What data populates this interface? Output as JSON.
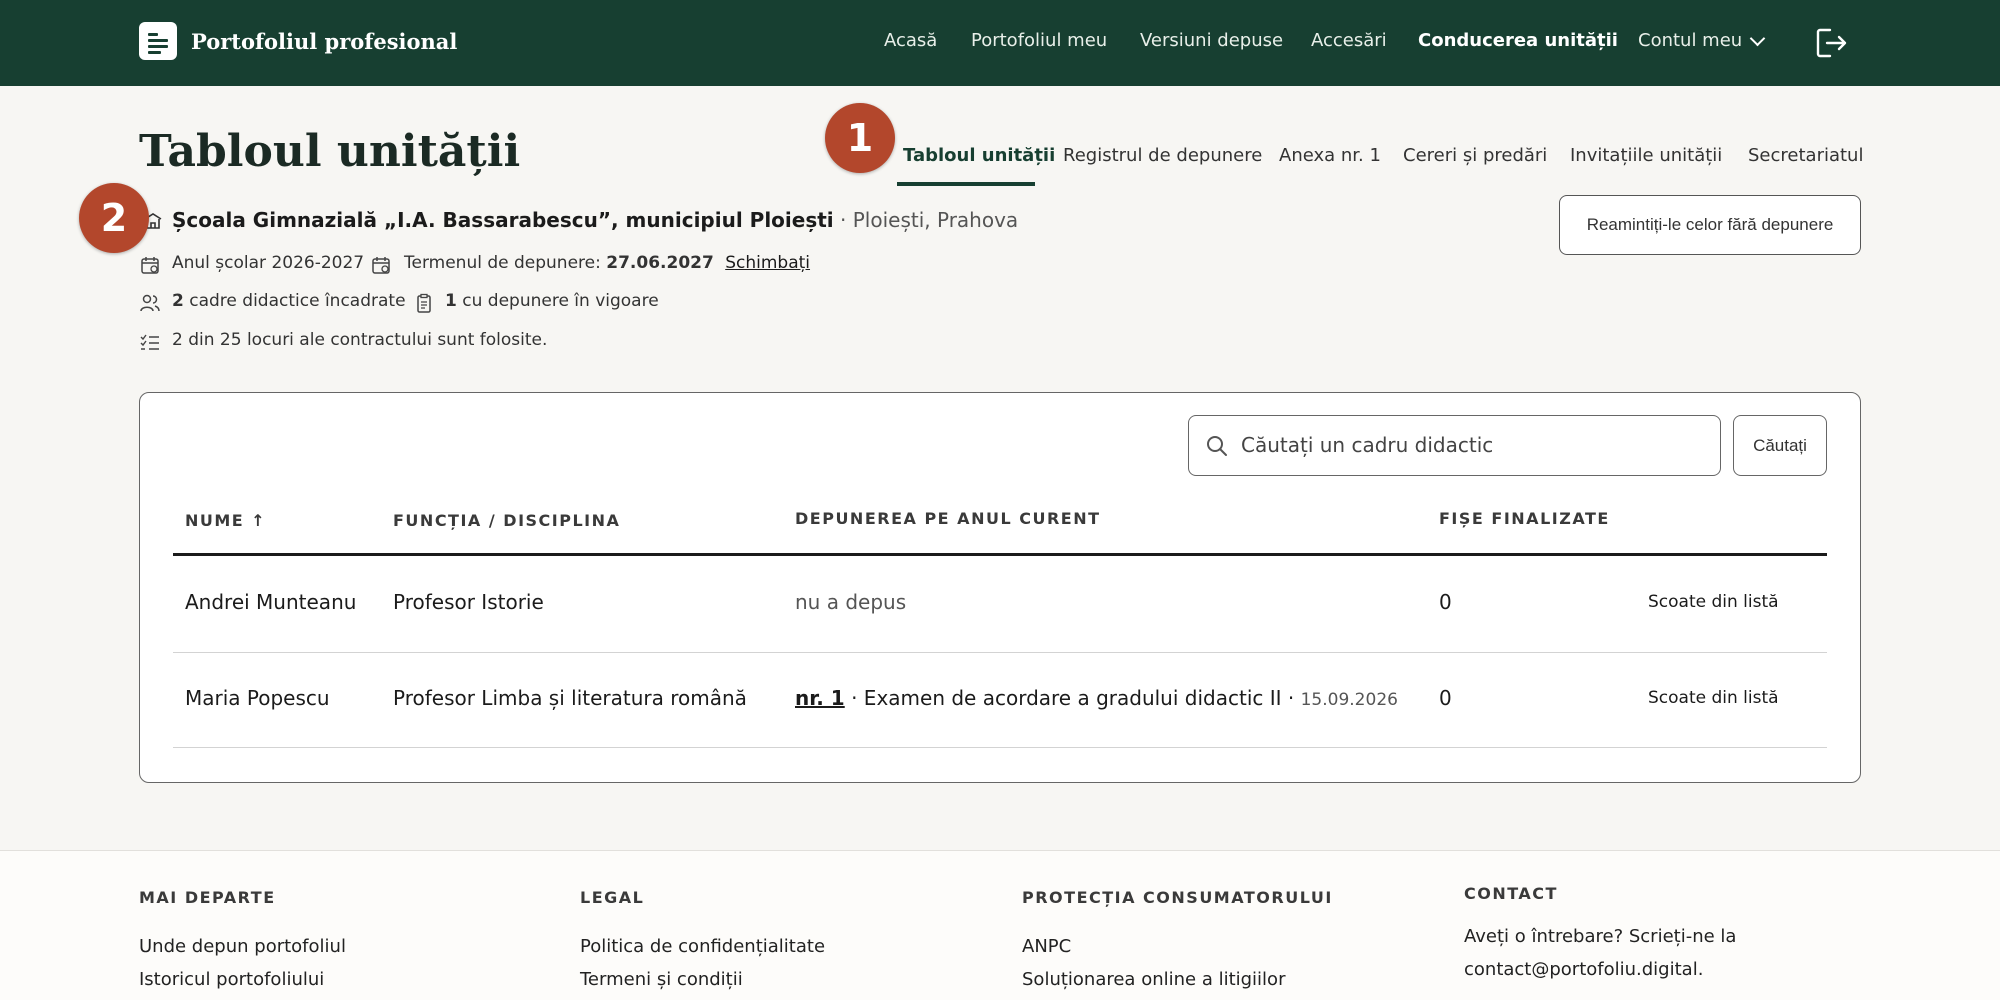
{
  "header": {
    "brand_title": "Portofoliul profesional",
    "nav": [
      "Acasă",
      "Portofoliul meu",
      "Versiuni depuse",
      "Accesări",
      "Conducerea unității",
      "Contul meu"
    ]
  },
  "page": {
    "title": "Tabloul unității",
    "tabs": [
      "Tabloul unității",
      "Registrul de depunere",
      "Anexa nr. 1",
      "Cereri și predări",
      "Invitațiile unității",
      "Secretariatul"
    ]
  },
  "markers": [
    "1",
    "2"
  ],
  "school": {
    "name": "Școala Gimnazială „I.A. Bassarabescu”, municipiul Ploiești",
    "location": "· Ploiești, Prahova"
  },
  "meta": {
    "school_year": "Anul școlar 2026-2027",
    "deadline_label": "Termenul de depunere:",
    "deadline_date": "27.06.2027",
    "change_link": "Schimbați",
    "staff_count": "2",
    "staff_text": "cadre didactice încadrate",
    "active_count": "1",
    "active_text": "cu depunere în vigoare",
    "contract_text": "2 din 25 locuri ale contractului sunt folosite."
  },
  "remind_button": "Reamintiți-le celor fără depunere",
  "search": {
    "placeholder": "Căutați un cadru didactic",
    "button": "Căutați"
  },
  "table": {
    "headers": [
      "NUME ↑",
      "FUNCȚIA / DISCIPLINA",
      "DEPUNEREA PE ANUL CURENT",
      "FIȘE FINALIZATE"
    ],
    "rows": [
      {
        "name": "Andrei Munteanu",
        "role": "Profesor Istorie",
        "submission": "nu a depus",
        "finalized": "0",
        "action": "Scoate din listă"
      },
      {
        "name": "Maria Popescu",
        "role": "Profesor Limba și literatura română",
        "submission_ref": "nr. 1",
        "submission_text": "· Examen de acordare a gradului didactic II ·",
        "submission_date": "15.09.2026",
        "finalized": "0",
        "action": "Scoate din listă"
      }
    ]
  },
  "footer": {
    "columns": [
      {
        "title": "MAI DEPARTE",
        "links": [
          "Unde depun portofoliul",
          "Istoricul portofoliului"
        ]
      },
      {
        "title": "LEGAL",
        "links": [
          "Politica de confidențialitate",
          "Termeni și condiții"
        ]
      },
      {
        "title": "PROTECȚIA CONSUMATORULUI",
        "links": [
          "ANPC",
          "Soluționarea online a litigiilor"
        ]
      },
      {
        "title": "CONTACT",
        "links": [
          "Aveți o întrebare? Scrieți-ne la",
          "contact@portofoliu.digital."
        ]
      }
    ]
  }
}
